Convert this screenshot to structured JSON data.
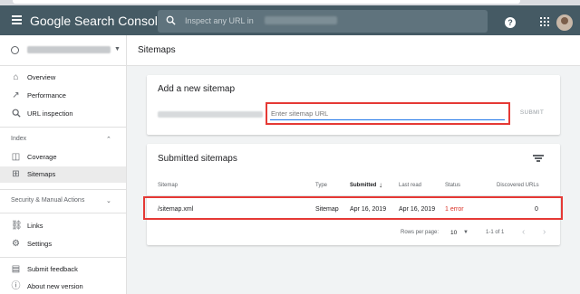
{
  "header": {
    "product_name": "Google Search Console",
    "search_placeholder": "Inspect any URL in"
  },
  "sidebar": {
    "items_main": [
      {
        "label": "Overview",
        "icon": "home-icon"
      },
      {
        "label": "Performance",
        "icon": "trending-icon"
      },
      {
        "label": "URL inspection",
        "icon": "search-icon"
      }
    ],
    "index_section": "Index",
    "items_index": [
      {
        "label": "Coverage",
        "icon": "coverage-icon"
      },
      {
        "label": "Sitemaps",
        "icon": "sitemap-icon",
        "active": true
      }
    ],
    "security_section": "Security & Manual Actions",
    "items_bottom": [
      {
        "label": "Links",
        "icon": "links-icon"
      },
      {
        "label": "Settings",
        "icon": "gear-icon"
      }
    ],
    "items_footer": [
      {
        "label": "Submit feedback",
        "icon": "feedback-icon"
      },
      {
        "label": "About new version",
        "icon": "info-icon"
      }
    ]
  },
  "main": {
    "page_title": "Sitemaps",
    "add_card": {
      "title": "Add a new sitemap",
      "input_placeholder": "Enter sitemap URL",
      "submit_label": "SUBMIT"
    },
    "submitted_card": {
      "title": "Submitted sitemaps",
      "columns": [
        "Sitemap",
        "Type",
        "Submitted",
        "Last read",
        "Status",
        "Discovered URLs"
      ],
      "rows": [
        {
          "sitemap": "/sitemap.xml",
          "type": "Sitemap",
          "submitted": "Apr 16, 2019",
          "last_read": "Apr 16, 2019",
          "status": "1 error",
          "discovered": "0"
        }
      ],
      "pagination": {
        "rows_per_page_label": "Rows per page:",
        "rows_per_page": "10",
        "range": "1-1 of 1"
      }
    }
  },
  "colors": {
    "header_bg": "#455a64",
    "highlight": "#e53935",
    "error": "#d93025",
    "focus": "#1a73e8"
  }
}
